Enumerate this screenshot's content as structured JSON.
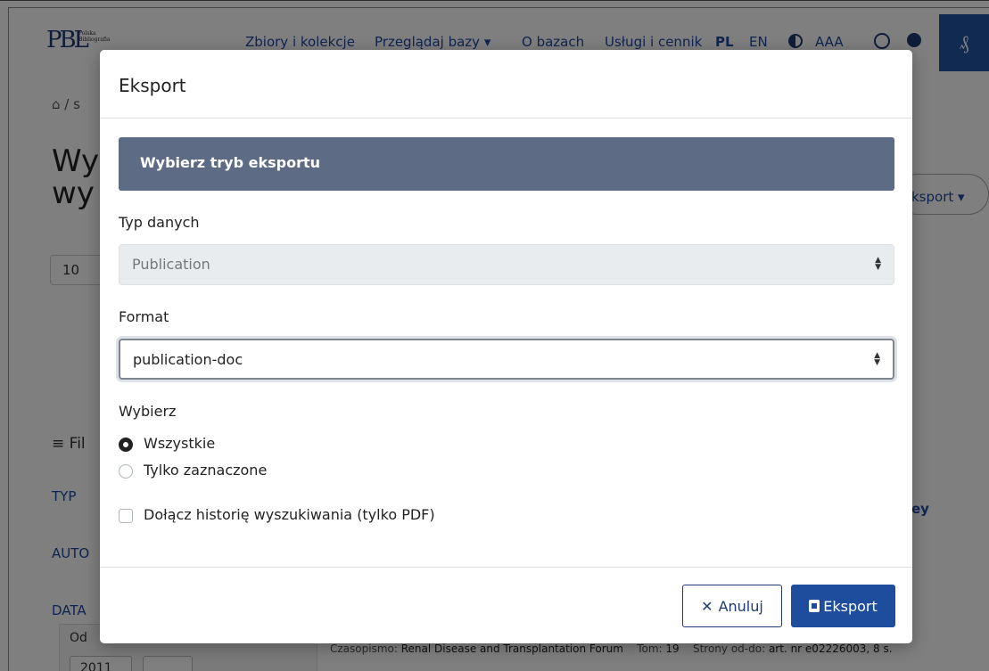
{
  "header": {
    "logo_mark": "PBL",
    "logo_text_1": "Polska",
    "logo_text_2": "Bibliografia",
    "nav_items": [
      "Zbiory i kolekcje",
      "Przeglądaj bazy ▾",
      "O bazach",
      "Usługi i cennik"
    ],
    "lang_pl": "PL",
    "lang_en": "EN",
    "font_size_label": "AAA"
  },
  "background": {
    "breadcrumb": "⌂  /  s",
    "heading_line1": "Wy",
    "heading_line2": "wy",
    "per_page": "10",
    "filters_title": "Fil",
    "facet_type": "TYP",
    "facet_author": "AUTO",
    "facet_date": "DATA",
    "date_from_label": "Od",
    "date_from_value": "2011",
    "export_button": "ksport ▾",
    "side_text": "ey",
    "journal_label": "Czasopismo:",
    "journal_name": "Renal Disease and Transplantation Forum",
    "volume_label": "Tom:",
    "volume_value": "19",
    "pages_label": "Strony od-do:",
    "pages_value": "art. nr e02226003, 8 s."
  },
  "modal": {
    "title": "Eksport",
    "banner": "Wybierz tryb eksportu",
    "data_type_label": "Typ danych",
    "data_type_value": "Publication",
    "format_label": "Format",
    "format_value": "publication-doc",
    "choose_label": "Wybierz",
    "option_all": "Wszystkie",
    "option_selected": "Tylko zaznaczone",
    "include_history": "Dołącz historię wyszukiwania (tylko PDF)",
    "cancel_button": "Anuluj",
    "export_button": "Eksport"
  },
  "colors": {
    "brand": "#1f3b73",
    "banner": "#5d6b85",
    "primary_button": "#1e4d9e"
  }
}
